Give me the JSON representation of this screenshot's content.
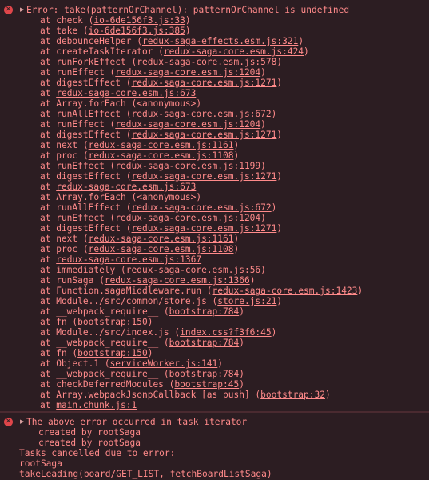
{
  "error1": {
    "message": "Error: take(patternOrChannel): patternOrChannel is undefined",
    "frames": [
      {
        "prefix": "at check (",
        "link": "io-6de156f3.js:33",
        "suffix": ")"
      },
      {
        "prefix": "at take (",
        "link": "io-6de156f3.js:385",
        "suffix": ")"
      },
      {
        "prefix": "at debounceHelper (",
        "link": "redux-saga-effects.esm.js:321",
        "suffix": ")"
      },
      {
        "prefix": "at createTaskIterator (",
        "link": "redux-saga-core.esm.js:424",
        "suffix": ")"
      },
      {
        "prefix": "at runForkEffect (",
        "link": "redux-saga-core.esm.js:578",
        "suffix": ")"
      },
      {
        "prefix": "at runEffect (",
        "link": "redux-saga-core.esm.js:1204",
        "suffix": ")"
      },
      {
        "prefix": "at digestEffect (",
        "link": "redux-saga-core.esm.js:1271",
        "suffix": ")"
      },
      {
        "prefix": "at ",
        "link": "redux-saga-core.esm.js:673",
        "suffix": ""
      },
      {
        "prefix": "at Array.forEach (<anonymous>)",
        "link": "",
        "suffix": ""
      },
      {
        "prefix": "at runAllEffect (",
        "link": "redux-saga-core.esm.js:672",
        "suffix": ")"
      },
      {
        "prefix": "at runEffect (",
        "link": "redux-saga-core.esm.js:1204",
        "suffix": ")"
      },
      {
        "prefix": "at digestEffect (",
        "link": "redux-saga-core.esm.js:1271",
        "suffix": ")"
      },
      {
        "prefix": "at next (",
        "link": "redux-saga-core.esm.js:1161",
        "suffix": ")"
      },
      {
        "prefix": "at proc (",
        "link": "redux-saga-core.esm.js:1108",
        "suffix": ")"
      },
      {
        "prefix": "at runEffect (",
        "link": "redux-saga-core.esm.js:1199",
        "suffix": ")"
      },
      {
        "prefix": "at digestEffect (",
        "link": "redux-saga-core.esm.js:1271",
        "suffix": ")"
      },
      {
        "prefix": "at ",
        "link": "redux-saga-core.esm.js:673",
        "suffix": ""
      },
      {
        "prefix": "at Array.forEach (<anonymous>)",
        "link": "",
        "suffix": ""
      },
      {
        "prefix": "at runAllEffect (",
        "link": "redux-saga-core.esm.js:672",
        "suffix": ")"
      },
      {
        "prefix": "at runEffect (",
        "link": "redux-saga-core.esm.js:1204",
        "suffix": ")"
      },
      {
        "prefix": "at digestEffect (",
        "link": "redux-saga-core.esm.js:1271",
        "suffix": ")"
      },
      {
        "prefix": "at next (",
        "link": "redux-saga-core.esm.js:1161",
        "suffix": ")"
      },
      {
        "prefix": "at proc (",
        "link": "redux-saga-core.esm.js:1108",
        "suffix": ")"
      },
      {
        "prefix": "at ",
        "link": "redux-saga-core.esm.js:1367",
        "suffix": ""
      },
      {
        "prefix": "at immediately (",
        "link": "redux-saga-core.esm.js:56",
        "suffix": ")"
      },
      {
        "prefix": "at runSaga (",
        "link": "redux-saga-core.esm.js:1366",
        "suffix": ")"
      },
      {
        "prefix": "at Function.sagaMiddleware.run (",
        "link": "redux-saga-core.esm.js:1423",
        "suffix": ")"
      },
      {
        "prefix": "at Module../src/common/store.js (",
        "link": "store.js:21",
        "suffix": ")"
      },
      {
        "prefix": "at __webpack_require__ (",
        "link": "bootstrap:784",
        "suffix": ")"
      },
      {
        "prefix": "at fn (",
        "link": "bootstrap:150",
        "suffix": ")"
      },
      {
        "prefix": "at Module../src/index.js (",
        "link": "index.css?f3f6:45",
        "suffix": ")"
      },
      {
        "prefix": "at __webpack_require__ (",
        "link": "bootstrap:784",
        "suffix": ")"
      },
      {
        "prefix": "at fn (",
        "link": "bootstrap:150",
        "suffix": ")"
      },
      {
        "prefix": "at Object.1 (",
        "link": "serviceWorker.js:141",
        "suffix": ")"
      },
      {
        "prefix": "at __webpack_require__ (",
        "link": "bootstrap:784",
        "suffix": ")"
      },
      {
        "prefix": "at checkDeferredModules (",
        "link": "bootstrap:45",
        "suffix": ")"
      },
      {
        "prefix": "at Array.webpackJsonpCallback [as push] (",
        "link": "bootstrap:32",
        "suffix": ")"
      },
      {
        "prefix": "at ",
        "link": "main.chunk.js:1",
        "suffix": ""
      }
    ]
  },
  "error2": {
    "message": "The above error occurred in task iterator",
    "created": [
      "created by rootSaga",
      "created by rootSaga"
    ],
    "lines": [
      "Tasks cancelled due to error:",
      "rootSaga",
      "takeLeading(board/GET_LIST, fetchBoardListSaga)"
    ]
  },
  "icons": {
    "error": "error-circle-icon",
    "expand": "expand-triangle-icon"
  },
  "colors": {
    "text": "#ff8a8a",
    "background": "#2c1d22",
    "icon": "#e0464a"
  }
}
